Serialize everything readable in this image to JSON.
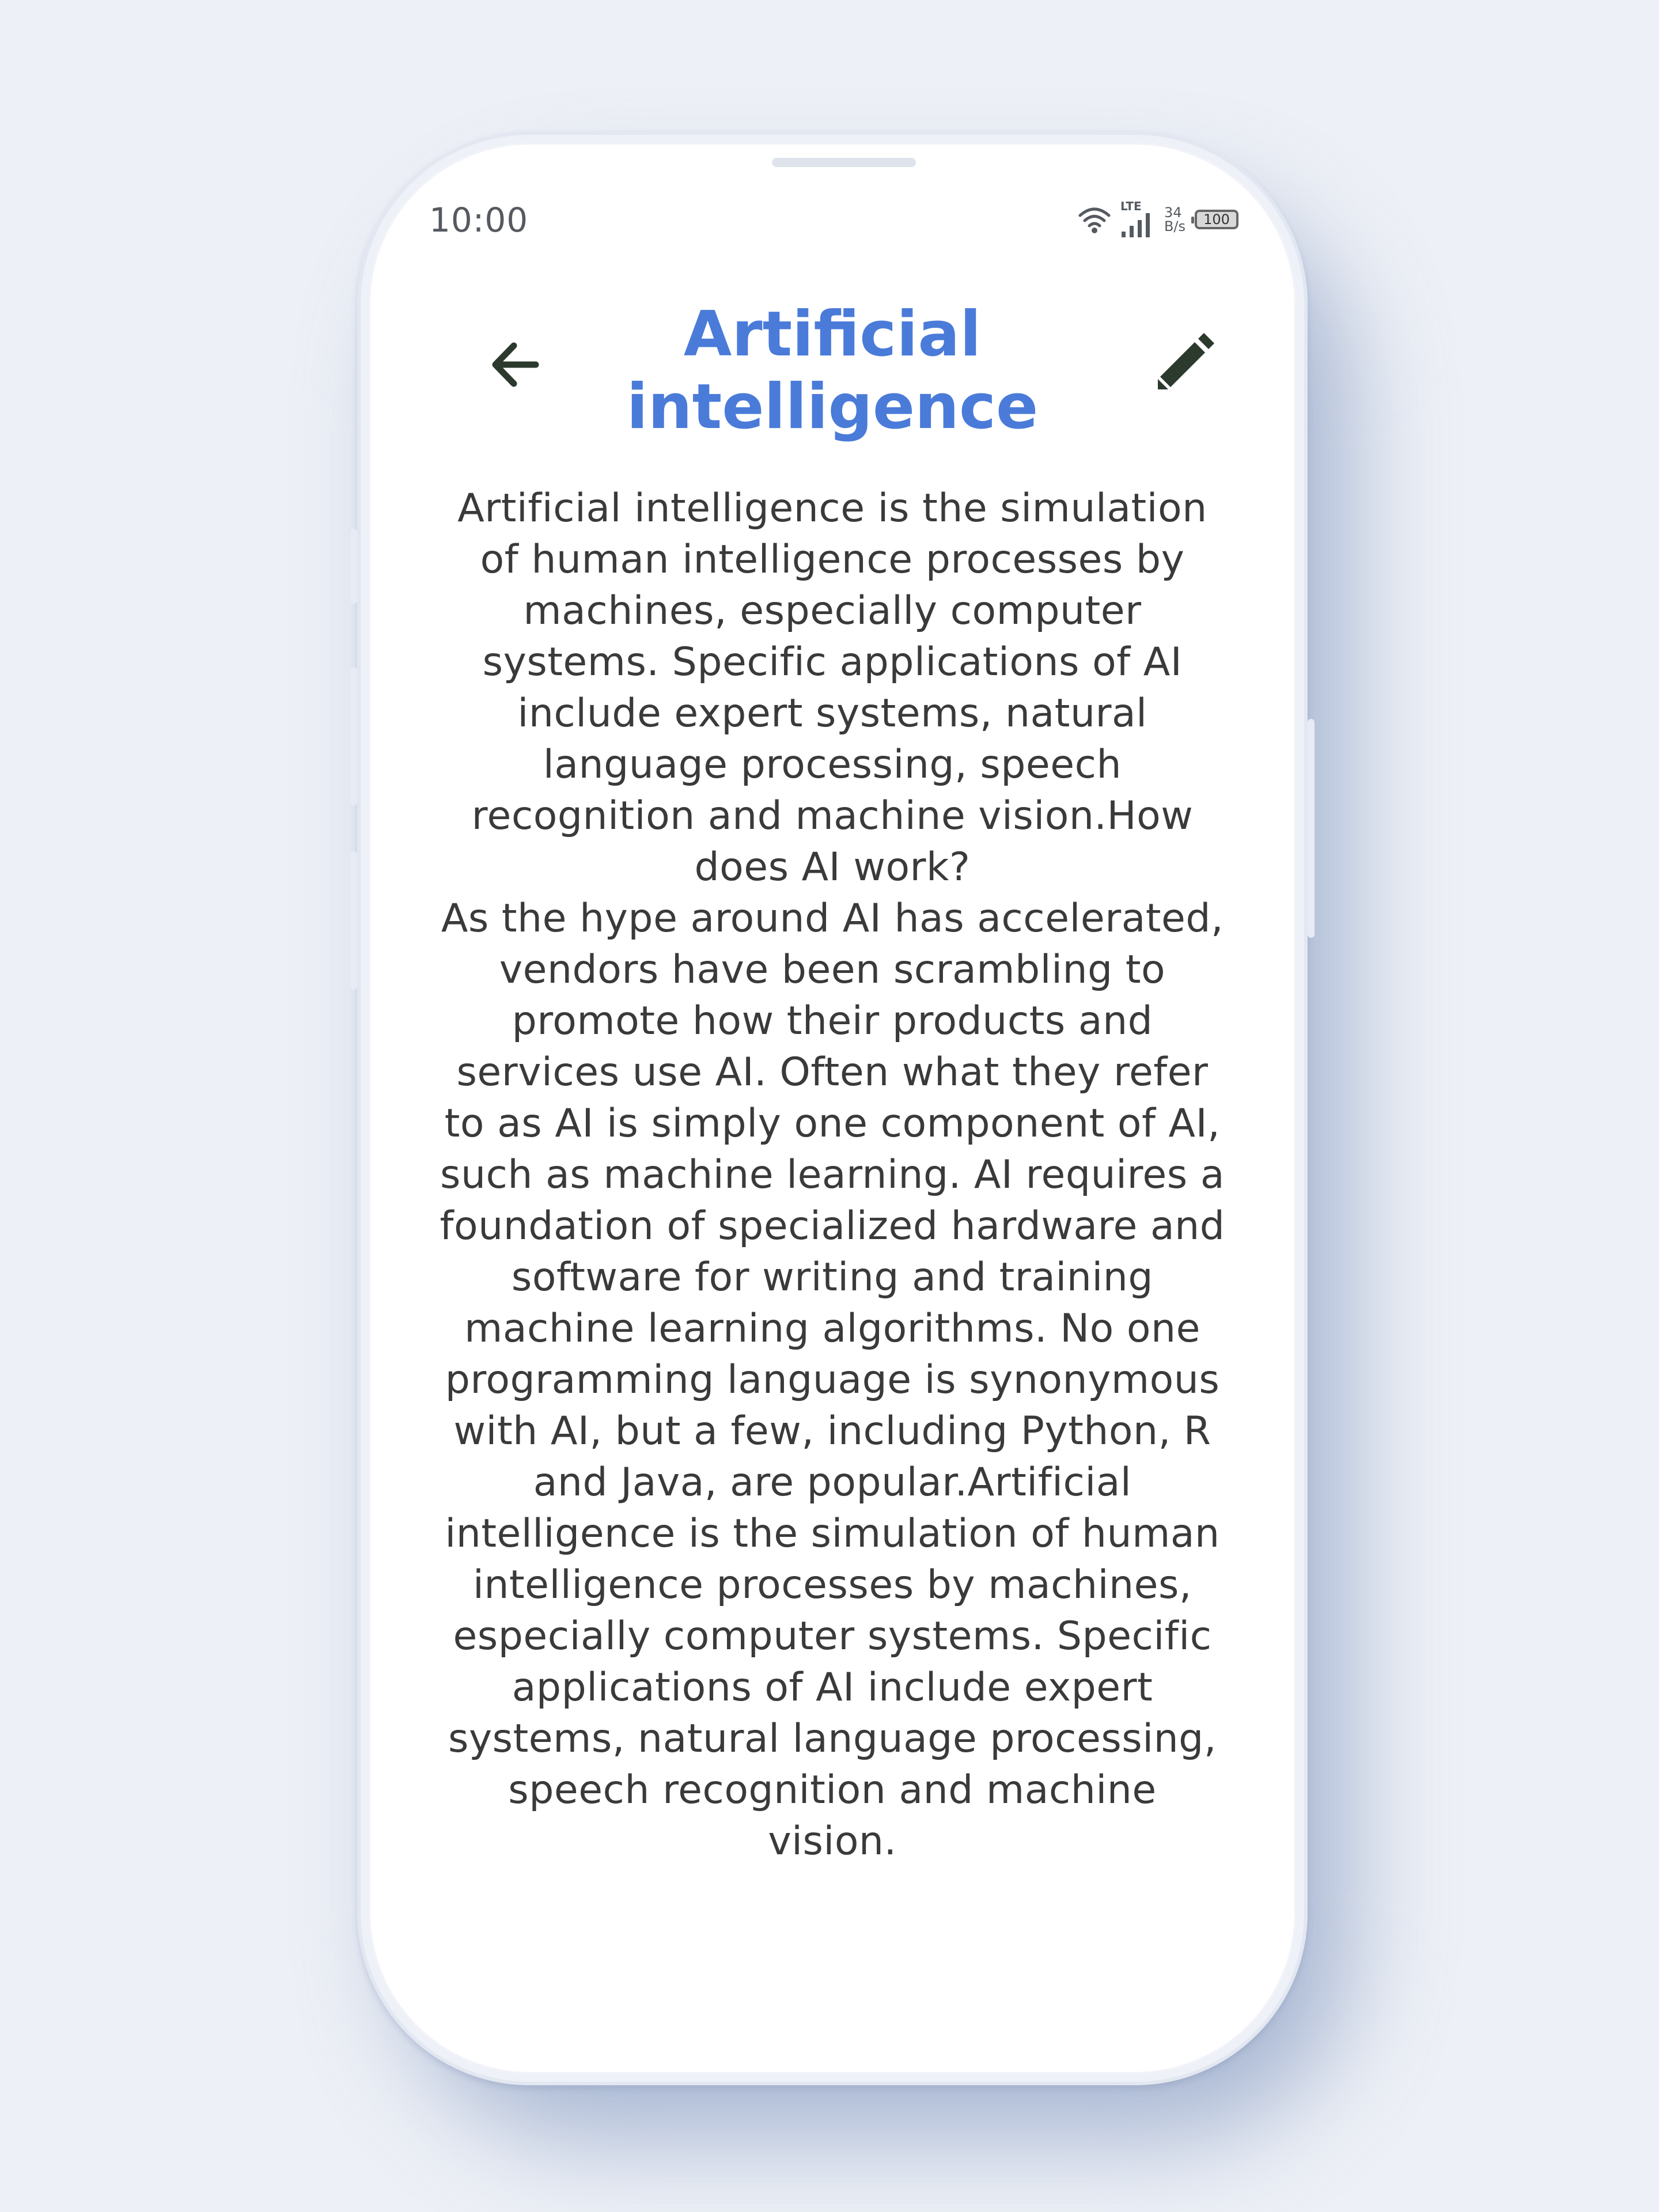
{
  "status_bar": {
    "time": "10:00",
    "network_type": "LTE",
    "speed_value": "34",
    "speed_unit": "B/s",
    "battery": "100"
  },
  "header": {
    "title": "Artificial\nintelligence",
    "back_icon": "arrow-left-icon",
    "edit_icon": "pencil-icon"
  },
  "content": {
    "text": "Artificial intelligence is the simulation of human intelligence processes by machines, especially computer systems. Specific applications of AI include expert systems, natural language processing, speech recognition and machine vision.How does AI work?\nAs the hype around AI has accelerated, vendors have been scrambling to promote how their products and services use AI. Often what they refer to as AI is simply one component of AI, such as machine learning. AI requires a foundation of specialized hardware and software for writing and training machine learning algorithms. No one programming language is synonymous with AI, but a few, including Python, R and Java, are popular.Artificial intelligence is the simulation of human intelligence processes by machines, especially computer systems. Specific applications of AI include expert systems, natural language processing, speech recognition and machine vision."
  },
  "colors": {
    "title": "#4a7bd9",
    "icon": "#2c3a2e",
    "body_text": "#3a3a3a",
    "background": "#edf0f6"
  }
}
